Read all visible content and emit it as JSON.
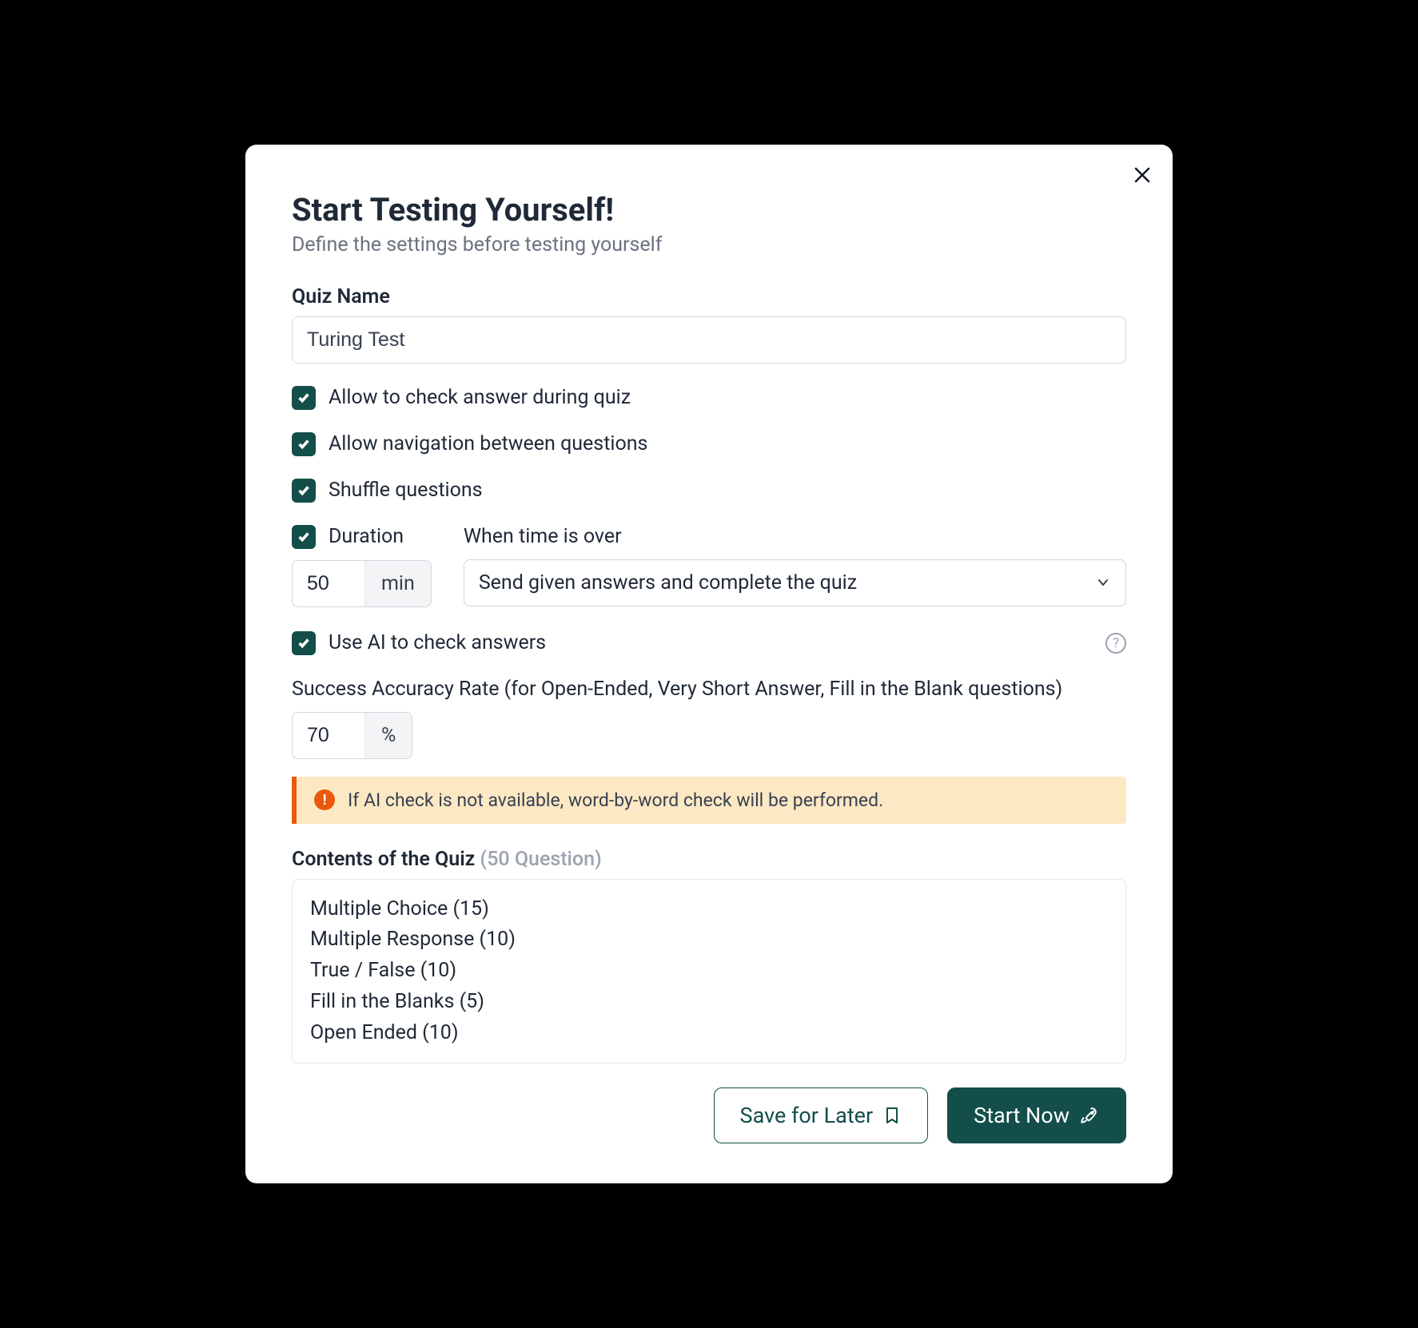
{
  "dialog": {
    "title": "Start Testing Yourself!",
    "subtitle": "Define the settings before testing yourself"
  },
  "quizName": {
    "label": "Quiz Name",
    "value": "Turing Test"
  },
  "options": {
    "checkAnswers": "Allow to check answer during quiz",
    "navigation": "Allow navigation between questions",
    "shuffle": "Shuffle questions"
  },
  "duration": {
    "label": "Duration",
    "value": "50",
    "unit": "min"
  },
  "whenOver": {
    "label": "When time is over",
    "value": "Send given answers and complete the quiz"
  },
  "ai": {
    "label": "Use AI to check answers"
  },
  "accuracy": {
    "label": "Success Accuracy Rate (for Open-Ended, Very Short Answer, Fill in the Blank questions)",
    "value": "70",
    "unit": "%"
  },
  "alert": {
    "text": "If AI check is not available, word-by-word check will be performed."
  },
  "contents": {
    "label": "Contents of the Quiz ",
    "count": "(50 Question)",
    "items": [
      "Multiple Choice (15)",
      "Multiple Response (10)",
      "True / False (10)",
      "Fill in the Blanks (5)",
      "Open Ended (10)"
    ]
  },
  "buttons": {
    "save": "Save for Later",
    "start": "Start Now"
  }
}
